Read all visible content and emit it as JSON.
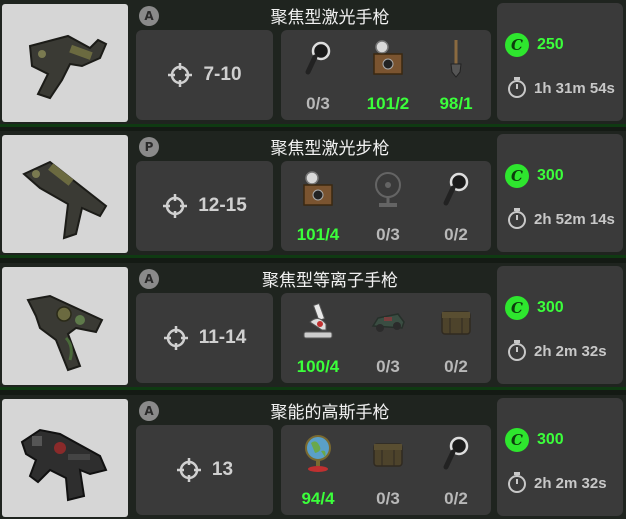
{
  "recipes": [
    {
      "weapon_name": "聚焦型激光手枪",
      "type_badge": "A",
      "damage": "7-10",
      "components": [
        {
          "icon": "magnifying-lens-icon",
          "count": "0/3",
          "status": "missing"
        },
        {
          "icon": "camera-icon",
          "count": "101/2",
          "status": "ok"
        },
        {
          "icon": "shovel-icon",
          "count": "98/1",
          "status": "ok"
        }
      ],
      "caps": "250",
      "time": "1h 31m 54s"
    },
    {
      "weapon_name": "聚焦型激光步枪",
      "type_badge": "P",
      "damage": "12-15",
      "components": [
        {
          "icon": "camera-icon",
          "count": "101/4",
          "status": "ok"
        },
        {
          "icon": "desk-fan-icon",
          "count": "0/3",
          "status": "missing"
        },
        {
          "icon": "magnifying-lens-icon",
          "count": "0/2",
          "status": "missing"
        }
      ],
      "caps": "300",
      "time": "2h 52m 14s"
    },
    {
      "weapon_name": "聚焦型等离子手枪",
      "type_badge": "A",
      "damage": "11-14",
      "components": [
        {
          "icon": "microscope-icon",
          "count": "100/4",
          "status": "ok"
        },
        {
          "icon": "toy-car-icon",
          "count": "0/3",
          "status": "missing"
        },
        {
          "icon": "ammo-box-icon",
          "count": "0/2",
          "status": "missing"
        }
      ],
      "caps": "300",
      "time": "2h 2m 32s"
    },
    {
      "weapon_name": "聚能的高斯手枪",
      "type_badge": "A",
      "damage": "13",
      "components": [
        {
          "icon": "globe-icon",
          "count": "94/4",
          "status": "ok"
        },
        {
          "icon": "ammo-box-icon",
          "count": "0/3",
          "status": "missing"
        },
        {
          "icon": "magnifying-lens-icon",
          "count": "0/2",
          "status": "missing"
        }
      ],
      "caps": "300",
      "time": "2h 2m 32s"
    }
  ],
  "caps_symbol": "C",
  "colors": {
    "available": "#3bff3b",
    "missing": "#b8b8b8",
    "caps": "#2ee62e",
    "panel": "#3a3a3a"
  }
}
